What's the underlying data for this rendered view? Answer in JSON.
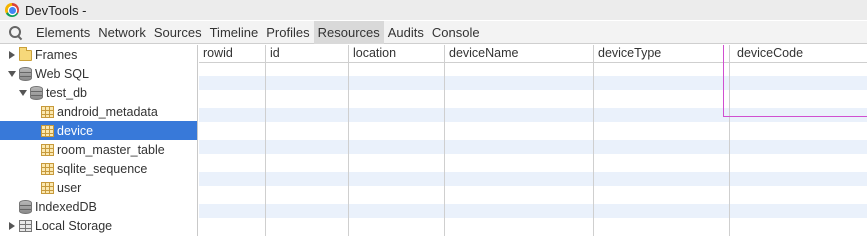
{
  "window": {
    "title": "DevTools -"
  },
  "toolbar": {
    "search_icon": "search-icon",
    "tabs": [
      {
        "label": "Elements"
      },
      {
        "label": "Network"
      },
      {
        "label": "Sources"
      },
      {
        "label": "Timeline"
      },
      {
        "label": "Profiles"
      },
      {
        "label": "Resources",
        "active": true
      },
      {
        "label": "Audits"
      },
      {
        "label": "Console"
      }
    ]
  },
  "sidebar": {
    "items": [
      {
        "label": "Frames",
        "icon": "folder-icon",
        "expanded": false
      },
      {
        "label": "Web SQL",
        "icon": "database-icon",
        "expanded": true
      },
      {
        "label": "test_db",
        "icon": "database-icon",
        "expanded": true
      },
      {
        "label": "android_metadata",
        "icon": "table-icon"
      },
      {
        "label": "device",
        "icon": "table-icon",
        "selected": true
      },
      {
        "label": "room_master_table",
        "icon": "table-icon"
      },
      {
        "label": "sqlite_sequence",
        "icon": "table-icon"
      },
      {
        "label": "user",
        "icon": "table-icon"
      },
      {
        "label": "IndexedDB",
        "icon": "database-icon"
      },
      {
        "label": "Local Storage",
        "icon": "storage-icon",
        "expanded": false
      }
    ]
  },
  "grid": {
    "columns": [
      "rowid",
      "id",
      "location",
      "deviceName",
      "deviceType",
      "deviceCode"
    ],
    "rows": []
  },
  "colors": {
    "selection": "#3879d9",
    "highlight_outline": "#d04fd0",
    "stripe": "#eaf1fb"
  }
}
